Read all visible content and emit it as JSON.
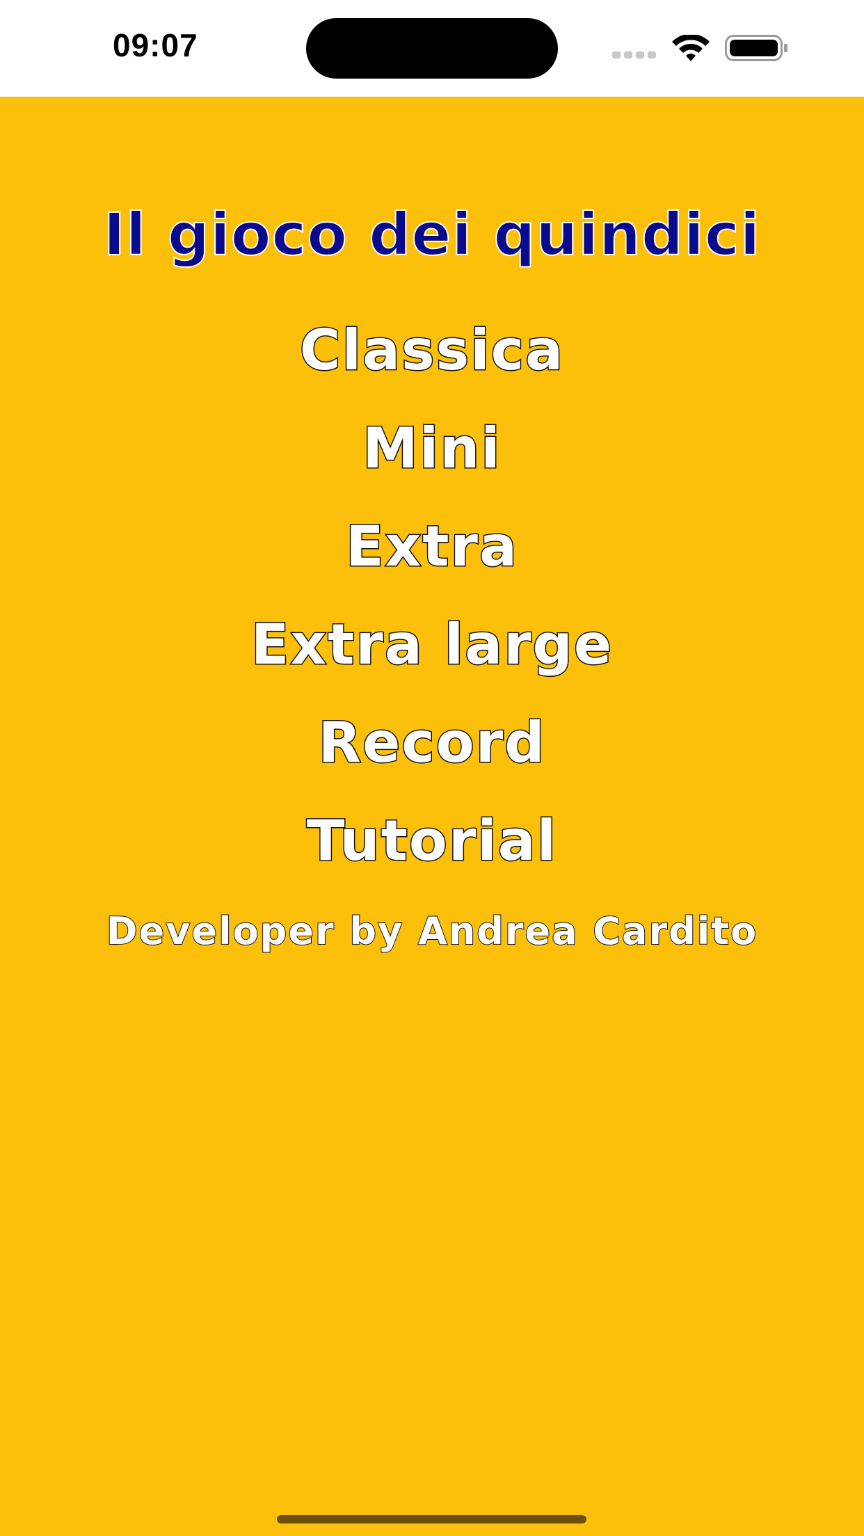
{
  "status_bar": {
    "time": "09:07"
  },
  "app": {
    "title": "Il gioco dei quindici",
    "menu": [
      {
        "label": "Classica"
      },
      {
        "label": "Mini"
      },
      {
        "label": "Extra"
      },
      {
        "label": "Extra large"
      },
      {
        "label": "Record"
      },
      {
        "label": "Tutorial"
      }
    ],
    "credit": "Developer by Andrea Cardito"
  },
  "colors": {
    "background": "#FDC00A",
    "title": "#0A0A8C",
    "menu_text": "#FFFFFF",
    "outline": "#111111"
  },
  "icons": [
    "signal-icon",
    "wifi-icon",
    "battery-icon"
  ]
}
